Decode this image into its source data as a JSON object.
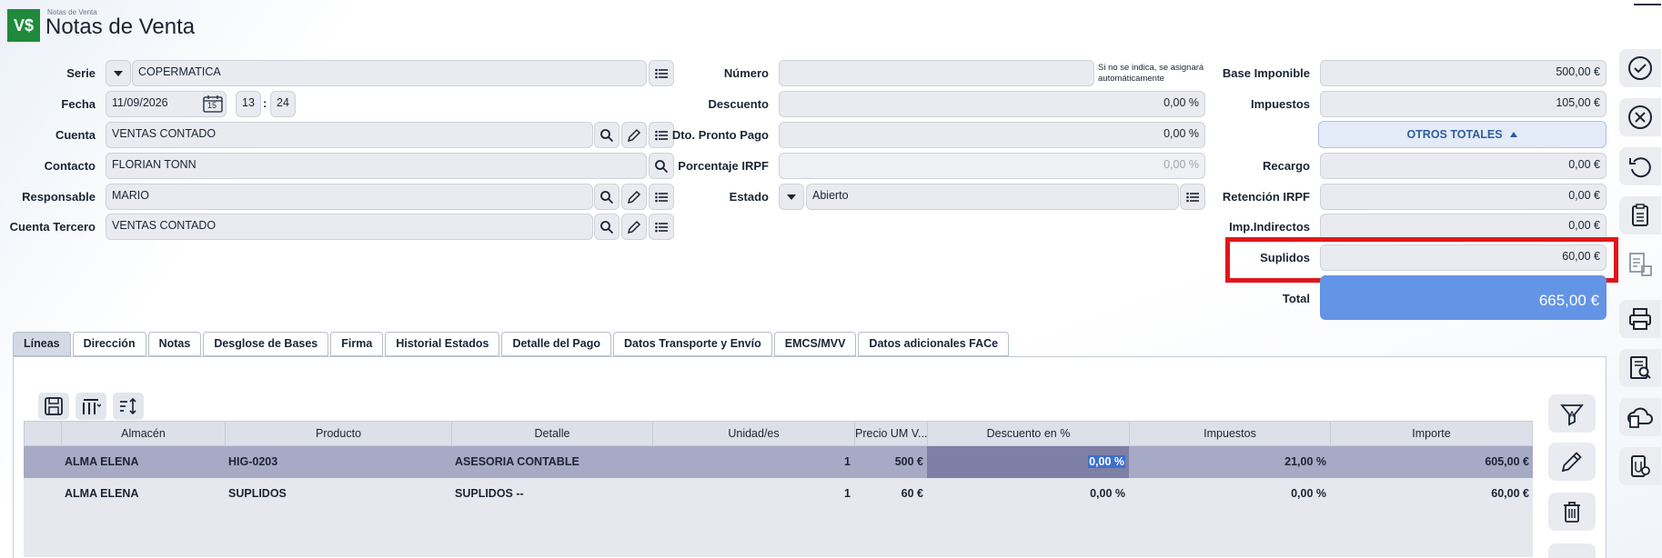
{
  "header": {
    "logo_text": "V$",
    "breadcrumb": "Notas de Venta",
    "title": "Notas de Venta"
  },
  "left_form": {
    "serie": {
      "label": "Serie",
      "value": "COPERMATICA"
    },
    "fecha": {
      "label": "Fecha",
      "date": "11/09/2026",
      "calendar_day": "15",
      "hour": "13",
      "sep": ":",
      "minute": "24"
    },
    "cuenta": {
      "label": "Cuenta",
      "value": "VENTAS CONTADO"
    },
    "contacto": {
      "label": "Contacto",
      "value": "FLORIAN TONN"
    },
    "responsable": {
      "label": "Responsable",
      "value": "MARIO"
    },
    "cuenta_tercero": {
      "label": "Cuenta Tercero",
      "value": "VENTAS CONTADO"
    }
  },
  "middle_form": {
    "numero": {
      "label": "Número",
      "value": "",
      "hint_line1": "Si no se indica, se asignará",
      "hint_line2": "automáticamente"
    },
    "descuento": {
      "label": "Descuento",
      "value": "0,00 %"
    },
    "dto_pronto_pago": {
      "label": "Dto. Pronto Pago",
      "value": "0,00 %"
    },
    "porcentaje_irpf": {
      "label": "Porcentaje IRPF",
      "value": "0,00 %"
    },
    "estado": {
      "label": "Estado",
      "value": "Abierto"
    }
  },
  "totals": {
    "base_imponible": {
      "label": "Base Imponible",
      "value": "500,00 €"
    },
    "impuestos": {
      "label": "Impuestos",
      "value": "105,00 €"
    },
    "otros_totales_label": "OTROS TOTALES",
    "recargo": {
      "label": "Recargo",
      "value": "0,00 €"
    },
    "retencion_irpf": {
      "label": "Retención IRPF",
      "value": "0,00 €"
    },
    "imp_indirectos": {
      "label": "Imp.Indirectos",
      "value": "0,00 €"
    },
    "suplidos": {
      "label": "Suplidos",
      "value": "60,00 €"
    },
    "total": {
      "label": "Total",
      "value": "665,00 €"
    }
  },
  "tabs": [
    {
      "label": "Líneas",
      "active": true
    },
    {
      "label": "Dirección"
    },
    {
      "label": "Notas"
    },
    {
      "label": "Desglose de Bases"
    },
    {
      "label": "Firma"
    },
    {
      "label": "Historial Estados"
    },
    {
      "label": "Detalle del Pago"
    },
    {
      "label": "Datos Transporte y Envío"
    },
    {
      "label": "EMCS/MVV"
    },
    {
      "label": "Datos adicionales FACe"
    }
  ],
  "grid": {
    "columns": [
      "",
      "Almacén",
      "Producto",
      "Detalle",
      "Unidad/es",
      "Precio UM V...",
      "Descuento en %",
      "Impuestos",
      "Importe"
    ],
    "rows": [
      {
        "almacen": "ALMA ELENA",
        "producto": "HIG-0203",
        "detalle": "ASESORIA CONTABLE",
        "unidades": "1",
        "precio": "500 €",
        "descuento": "0,00 %",
        "impuestos": "21,00 %",
        "importe": "605,00 €",
        "selected": true
      },
      {
        "almacen": "ALMA ELENA",
        "producto": "SUPLIDOS",
        "detalle": "SUPLIDOS --",
        "unidades": "1",
        "precio": "60 €",
        "descuento": "0,00 %",
        "impuestos": "0,00 %",
        "importe": "60,00 €"
      }
    ]
  },
  "colors": {
    "total_bg": "#6494e6",
    "highlight_border": "#e0161b",
    "logo_bg": "#1f8a3b",
    "selected_row": "#a7aac4"
  },
  "icons": [
    "check-circle-icon",
    "close-circle-icon",
    "undo-icon",
    "clipboard-icon",
    "document-delete-icon",
    "printer-icon",
    "search-document-icon",
    "cloud-document-icon",
    "attachment-search-icon",
    "save-icon",
    "columns-icon",
    "sort-icon",
    "filter-icon",
    "edit-icon",
    "trash-icon"
  ]
}
